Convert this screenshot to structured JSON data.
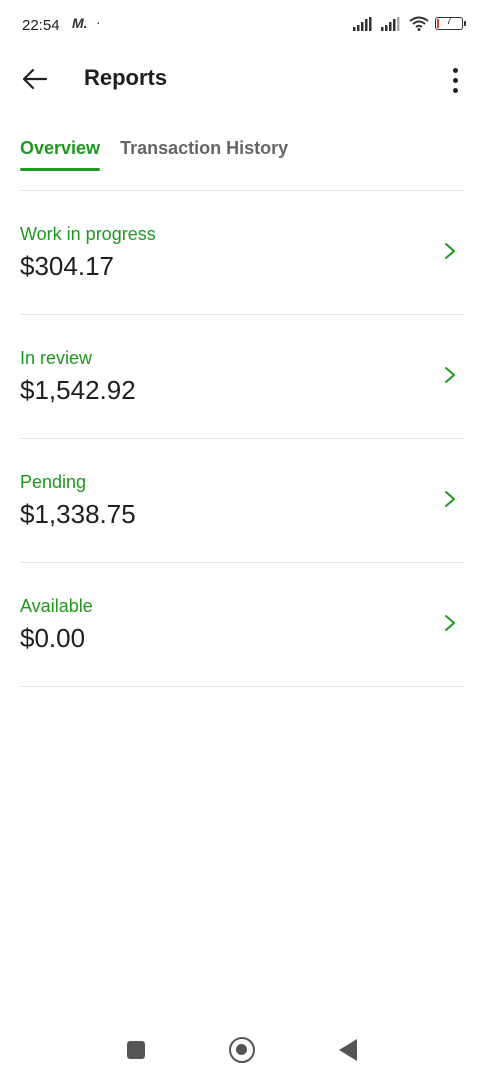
{
  "status_bar": {
    "time": "22:54",
    "app_icon_text": "M.",
    "dot": "·",
    "battery_level": "7"
  },
  "app_bar": {
    "title": "Reports"
  },
  "tabs": [
    {
      "label": "Overview",
      "active": true
    },
    {
      "label": "Transaction History",
      "active": false
    }
  ],
  "rows": [
    {
      "label": "Work in progress",
      "amount": "$304.17"
    },
    {
      "label": "In review",
      "amount": "$1,542.92"
    },
    {
      "label": "Pending",
      "amount": "$1,338.75"
    },
    {
      "label": "Available",
      "amount": "$0.00"
    }
  ],
  "colors": {
    "accent": "#1c9a1c",
    "text": "#1f1f1f",
    "muted": "#666666",
    "divider": "#e4e4e4"
  },
  "icons": {
    "back": "arrow-left-icon",
    "more": "more-vertical-icon",
    "row_chevron": "chevron-right-icon",
    "nav_recents": "square-icon",
    "nav_home": "circle-icon",
    "nav_back": "triangle-left-icon"
  }
}
